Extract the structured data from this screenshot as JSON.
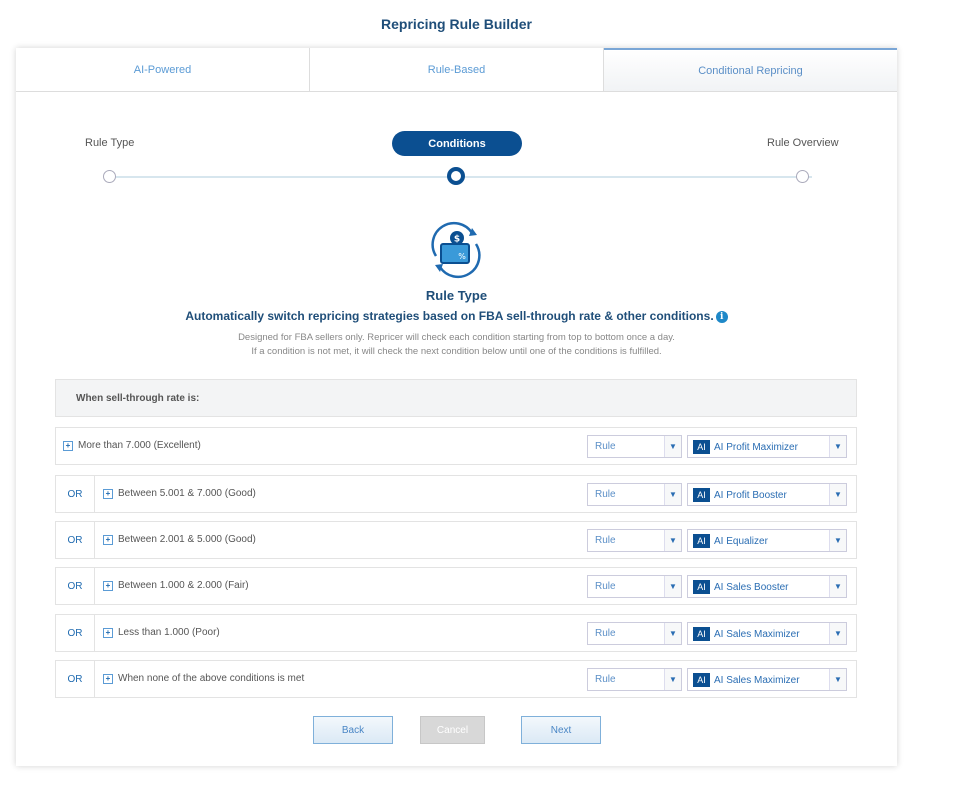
{
  "page_title": "Repricing Rule Builder",
  "tabs": [
    {
      "label": "AI-Powered",
      "active": false
    },
    {
      "label": "Rule-Based",
      "active": false
    },
    {
      "label": "Conditional Repricing",
      "active": true
    }
  ],
  "steps": [
    {
      "label": "Rule Type",
      "active": false
    },
    {
      "label": "Conditions",
      "active": true
    },
    {
      "label": "Rule Overview",
      "active": false
    }
  ],
  "rule_type": {
    "icon": "repricing-cycle-icon",
    "title": "Rule Type",
    "subtitle": "Automatically switch repricing strategies based on FBA sell-through rate & other conditions.",
    "info_icon": "info-icon",
    "info_glyph": "i",
    "description_line1": "Designed for FBA sellers only. Repricer will check each condition starting from top to bottom once a day.",
    "description_line2": "If a condition is not met, it will check the next condition below until one of the conditions is fulfilled."
  },
  "conditions_header": "When sell-through rate is:",
  "ai_badge": "AI",
  "expand_glyph": "+",
  "dropdown_glyph": "▼",
  "conditions": [
    {
      "prefix": "",
      "label": "More than 7.000 (Excellent)",
      "rule": "Rule",
      "strategy": "AI Profit Maximizer"
    },
    {
      "prefix": "OR",
      "label": "Between 5.001 & 7.000 (Good)",
      "rule": "Rule",
      "strategy": "AI Profit Booster"
    },
    {
      "prefix": "OR",
      "label": "Between 2.001 & 5.000 (Good)",
      "rule": "Rule",
      "strategy": "AI Equalizer"
    },
    {
      "prefix": "OR",
      "label": "Between 1.000 & 2.000 (Fair)",
      "rule": "Rule",
      "strategy": "AI Sales Booster"
    },
    {
      "prefix": "OR",
      "label": "Less than 1.000 (Poor)",
      "rule": "Rule",
      "strategy": "AI Sales Maximizer"
    },
    {
      "prefix": "OR",
      "label": "When none of the above conditions is met",
      "rule": "Rule",
      "strategy": "AI Sales Maximizer"
    }
  ],
  "buttons": {
    "back": "Back",
    "cancel": "Cancel",
    "next": "Next"
  },
  "colors": {
    "primary": "#0b4f91",
    "accent": "#5b9bd5",
    "heading": "#1f4e79"
  }
}
